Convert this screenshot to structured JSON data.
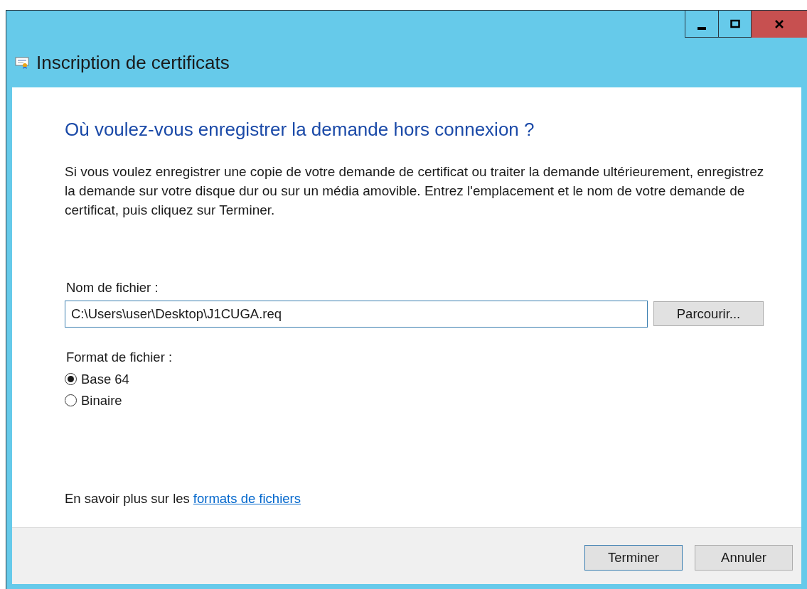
{
  "window": {
    "title": "Inscription de certificats",
    "controls": [
      {
        "kind": "minimize"
      },
      {
        "kind": "maximize"
      },
      {
        "kind": "close"
      }
    ]
  },
  "heading": "Où voulez-vous enregistrer la demande hors connexion ?",
  "description": "Si vous voulez enregistrer une copie de votre demande de certificat ou traiter la demande ultérieurement, enregistrez la demande sur votre disque dur ou sur un média amovible. Entrez l'emplacement et le nom de votre demande de certificat, puis cliquez sur Terminer.",
  "file_name": {
    "label": "Nom de fichier :",
    "value": "C:\\Users\\user\\Desktop\\J1CUGA.req",
    "browse_button": {
      "label": "Parcourir..."
    }
  },
  "file_format": {
    "label": "Format de fichier :",
    "options": [
      {
        "label": "Base 64",
        "selected": true
      },
      {
        "label": "Binaire",
        "selected": false
      }
    ]
  },
  "help": {
    "text": "En savoir plus sur les",
    "link": "formats de fichiers"
  },
  "buttons": [
    {
      "label": "Terminer",
      "default": true
    },
    {
      "label": "Annuler",
      "default": false
    }
  ]
}
